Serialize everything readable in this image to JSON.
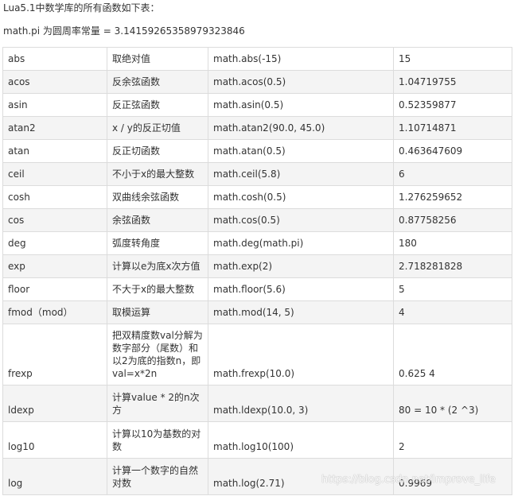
{
  "intro": {
    "line1": "Lua5.1中数学库的所有函数如下表：",
    "line2": "math.pi 为圆周率常量 = 3.14159265358979323846"
  },
  "rows": [
    {
      "name": "abs",
      "desc": "取绝对值",
      "example": "math.abs(-15)",
      "result": "15"
    },
    {
      "name": "acos",
      "desc": "反余弦函数",
      "example": "math.acos(0.5)",
      "result": "1.04719755"
    },
    {
      "name": "asin",
      "desc": "反正弦函数",
      "example": "math.asin(0.5)",
      "result": "0.52359877"
    },
    {
      "name": "atan2",
      "desc": "x / y的反正切值",
      "example": "math.atan2(90.0, 45.0)",
      "result": "1.10714871"
    },
    {
      "name": "atan",
      "desc": "反正切函数",
      "example": "math.atan(0.5)",
      "result": "0.463647609"
    },
    {
      "name": "ceil",
      "desc": "不小于x的最大整数",
      "example": "math.ceil(5.8)",
      "result": "6"
    },
    {
      "name": "cosh",
      "desc": "双曲线余弦函数",
      "example": "math.cosh(0.5)",
      "result": "1.276259652"
    },
    {
      "name": "cos",
      "desc": "余弦函数",
      "example": "math.cos(0.5)",
      "result": "0.87758256"
    },
    {
      "name": "deg",
      "desc": "弧度转角度",
      "example": "math.deg(math.pi)",
      "result": "180"
    },
    {
      "name": "exp",
      "desc": "计算以e为底x次方值",
      "example": "math.exp(2)",
      "result": "2.718281828"
    },
    {
      "name": "floor",
      "desc": "不大于x的最大整数",
      "example": "math.floor(5.6)",
      "result": "5"
    },
    {
      "name": "fmod（mod）",
      "desc": "取模运算",
      "example": "math.mod(14, 5)",
      "result": "4"
    },
    {
      "name": "frexp",
      "desc": "把双精度数val分解为数字部分（尾数）和以2为底的指数n，即val=x*2n",
      "example": "math.frexp(10.0)",
      "result": "0.625    4"
    },
    {
      "name": "ldexp",
      "desc": "计算value * 2的n次方",
      "example": "math.ldexp(10.0, 3)",
      "result": "80 = 10 * (2 ^3)"
    },
    {
      "name": "log10",
      "desc": "计算以10为基数的对数",
      "example": "math.log10(100)",
      "result": "2"
    },
    {
      "name": "log",
      "desc": "计算一个数字的自然对数",
      "example": "math.log(2.71)",
      "result": "0.9969"
    }
  ],
  "watermark": "https://blog.csdn.net/Improve_life"
}
